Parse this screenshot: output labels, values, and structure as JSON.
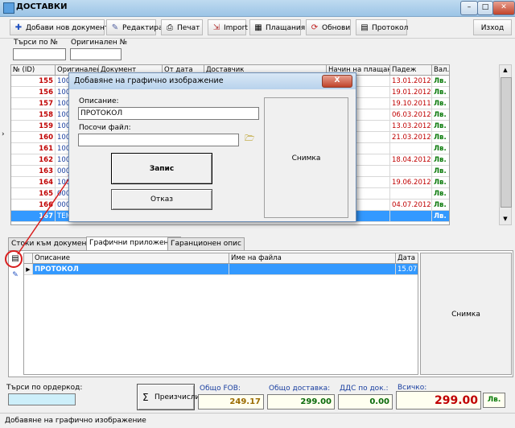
{
  "window": {
    "title": "ДОСТАВКИ",
    "close_glyph": "✕"
  },
  "toolbar": {
    "add": "Добави нов документ",
    "edit": "Редактирай",
    "print": "Печат",
    "import": "Import",
    "payments": "Плащания",
    "refresh": "Обнови",
    "protocol": "Протокол",
    "exit": "Изход"
  },
  "search": {
    "by_no_label": "Търси по №",
    "original_no_label": "Оригинален №",
    "by_order_label": "Търси по ордеркод:"
  },
  "grid": {
    "columns": [
      "№ (ID)",
      "Оригинален №",
      "Документ",
      "От дата",
      "Доставчик",
      "Начин на плащане",
      "Падеж",
      "Вал."
    ],
    "rows": [
      {
        "id": "155",
        "orig": "100",
        "date": "13.01.2012",
        "cur": "Лв."
      },
      {
        "id": "156",
        "orig": "100",
        "date": "19.01.2012",
        "cur": "Лв."
      },
      {
        "id": "157",
        "orig": "100",
        "date": "19.10.2011",
        "cur": "Лв."
      },
      {
        "id": "158",
        "orig": "100",
        "date": "06.03.2012",
        "cur": "Лв."
      },
      {
        "id": "159",
        "orig": "100",
        "date": "13.03.2012",
        "cur": "Лв."
      },
      {
        "id": "160",
        "orig": "100",
        "date": "21.03.2012",
        "cur": "Лв."
      },
      {
        "id": "161",
        "orig": "100",
        "date": "",
        "cur": "Лв."
      },
      {
        "id": "162",
        "orig": "100",
        "date": "18.04.2012",
        "cur": "Лв."
      },
      {
        "id": "163",
        "orig": "000",
        "date": "",
        "cur": "Лв."
      },
      {
        "id": "164",
        "orig": "100",
        "date": "19.06.2012",
        "cur": "Лв."
      },
      {
        "id": "165",
        "orig": "000",
        "date": "",
        "cur": "Лв."
      },
      {
        "id": "166",
        "orig": "000",
        "date": "04.07.2012",
        "cur": "Лв."
      },
      {
        "id": "167",
        "orig": "TEM",
        "date": "",
        "cur": "Лв."
      }
    ]
  },
  "tabs": [
    "Стоки към документа",
    "Графични приложения",
    "Гаранционен опис"
  ],
  "attachments": {
    "columns": [
      "Описание",
      "Име на файла",
      "Дата"
    ],
    "row": {
      "desc": "ПРОТОКОЛ",
      "date": "15.07."
    },
    "snapshot_label": "Снимка"
  },
  "totals": {
    "recalc_label": "Преизчисли",
    "fob_label": "Общо FOB:",
    "fob_value": "249.17",
    "delivery_label": "Общо доставка:",
    "delivery_value": "299.00",
    "vat_label": "ДДС по док.:",
    "vat_value": "0.00",
    "total_label": "Всичко:",
    "total_value": "299.00",
    "currency": "Лв."
  },
  "dialog": {
    "title": "Добавяне на графично изображение",
    "close_label": "X",
    "description_label": "Описание:",
    "description_value": "ПРОТОКОЛ",
    "file_label": "Посочи файл:",
    "file_value": "",
    "save_label": "Запис",
    "cancel_label": "Отказ",
    "snapshot_label": "Снимка"
  },
  "status": {
    "text": "Добавяне на графично изображение"
  },
  "colors": {
    "id_red": "#c00000",
    "selected_row": "#3399ff",
    "annotation_red": "#d81e1e",
    "green_currency": "#0a7a0a"
  }
}
